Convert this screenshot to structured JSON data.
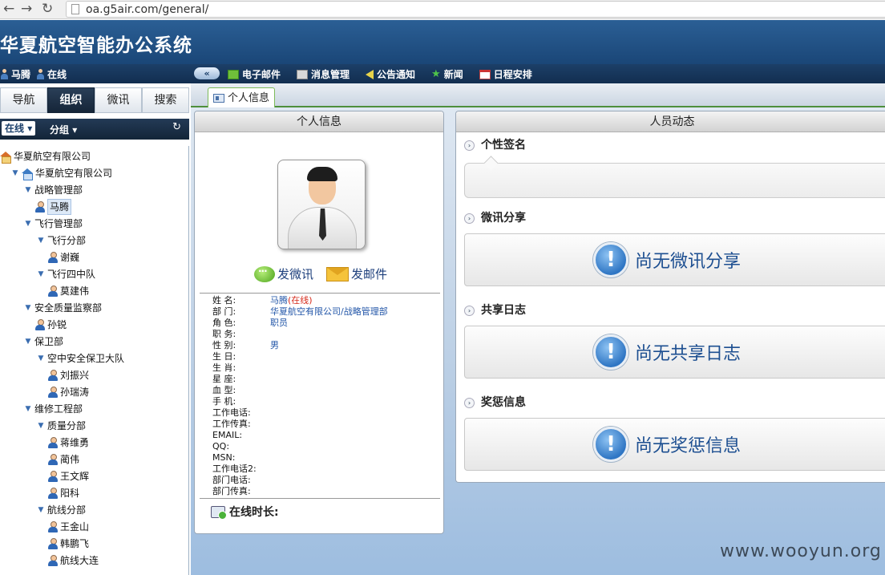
{
  "browser": {
    "url": "oa.g5air.com/general/"
  },
  "header": {
    "title": "华夏航空智能办公系统"
  },
  "topbar": {
    "user_name": "马腾",
    "user_status": "在线",
    "collapse": "«",
    "links": [
      {
        "label": "电子邮件",
        "icon": "mail-icon"
      },
      {
        "label": "消息管理",
        "icon": "message-icon"
      },
      {
        "label": "公告通知",
        "icon": "notice-icon"
      },
      {
        "label": "新闻",
        "icon": "news-icon"
      },
      {
        "label": "日程安排",
        "icon": "calendar-icon"
      }
    ]
  },
  "sidebar": {
    "tabs": [
      "导航",
      "组织",
      "微讯",
      "搜索"
    ],
    "active_tab": "组织",
    "filters": [
      "在线",
      "分组"
    ],
    "tree": [
      {
        "label": "华夏航空有限公司",
        "type": "org-root"
      },
      {
        "label": "华夏航空有限公司",
        "type": "org"
      },
      {
        "label": "战略管理部",
        "type": "dept"
      },
      {
        "label": "马腾",
        "type": "user"
      },
      {
        "label": "飞行管理部",
        "type": "dept"
      },
      {
        "label": "飞行分部",
        "type": "dept"
      },
      {
        "label": "谢巍",
        "type": "user"
      },
      {
        "label": "飞行四中队",
        "type": "dept"
      },
      {
        "label": "莫建伟",
        "type": "user"
      },
      {
        "label": "安全质量监察部",
        "type": "dept"
      },
      {
        "label": "孙锐",
        "type": "user"
      },
      {
        "label": "保卫部",
        "type": "dept"
      },
      {
        "label": "空中安全保卫大队",
        "type": "dept"
      },
      {
        "label": "刘振兴",
        "type": "user"
      },
      {
        "label": "孙瑞涛",
        "type": "user"
      },
      {
        "label": "维修工程部",
        "type": "dept"
      },
      {
        "label": "质量分部",
        "type": "dept"
      },
      {
        "label": "蒋维勇",
        "type": "user"
      },
      {
        "label": "蔺伟",
        "type": "user"
      },
      {
        "label": "王文辉",
        "type": "user"
      },
      {
        "label": "阳科",
        "type": "user"
      },
      {
        "label": "航线分部",
        "type": "dept"
      },
      {
        "label": "王金山",
        "type": "user"
      },
      {
        "label": "韩鹏飞",
        "type": "user"
      },
      {
        "label": "航线大连",
        "type": "user"
      }
    ]
  },
  "main": {
    "tab_label": "个人信息",
    "profile": {
      "title": "个人信息",
      "action_weixun": "发微讯",
      "action_mail": "发邮件",
      "fields": [
        {
          "label": "姓 名:",
          "value": "马腾",
          "tag": "(在线)"
        },
        {
          "label": "部 门:",
          "value": "华夏航空有限公司/战略管理部"
        },
        {
          "label": "角 色:",
          "value": "职员"
        },
        {
          "label": "职 务:",
          "value": ""
        },
        {
          "label": "性 别:",
          "value": "男"
        },
        {
          "label": "生 日:",
          "value": ""
        },
        {
          "label": "生 肖:",
          "value": ""
        },
        {
          "label": "星 座:",
          "value": ""
        },
        {
          "label": "血 型:",
          "value": ""
        },
        {
          "label": "手 机:",
          "value": ""
        },
        {
          "label": "工作电话:",
          "value": ""
        },
        {
          "label": "工作传真:",
          "value": ""
        },
        {
          "label": "EMAIL:",
          "value": ""
        },
        {
          "label": "QQ:",
          "value": ""
        },
        {
          "label": "MSN:",
          "value": ""
        },
        {
          "label": "工作电话2:",
          "value": ""
        },
        {
          "label": "部门电话:",
          "value": ""
        },
        {
          "label": "部门传真:",
          "value": ""
        }
      ],
      "online_time_label": "在线时长:"
    },
    "activity": {
      "title": "人员动态",
      "signature_title": "个性签名",
      "sections": [
        {
          "title": "微讯分享",
          "empty": "尚无微讯分享"
        },
        {
          "title": "共享日志",
          "empty": "尚无共享日志"
        },
        {
          "title": "奖惩信息",
          "empty": "尚无奖惩信息"
        }
      ]
    }
  },
  "watermark": "www.wooyun.org"
}
